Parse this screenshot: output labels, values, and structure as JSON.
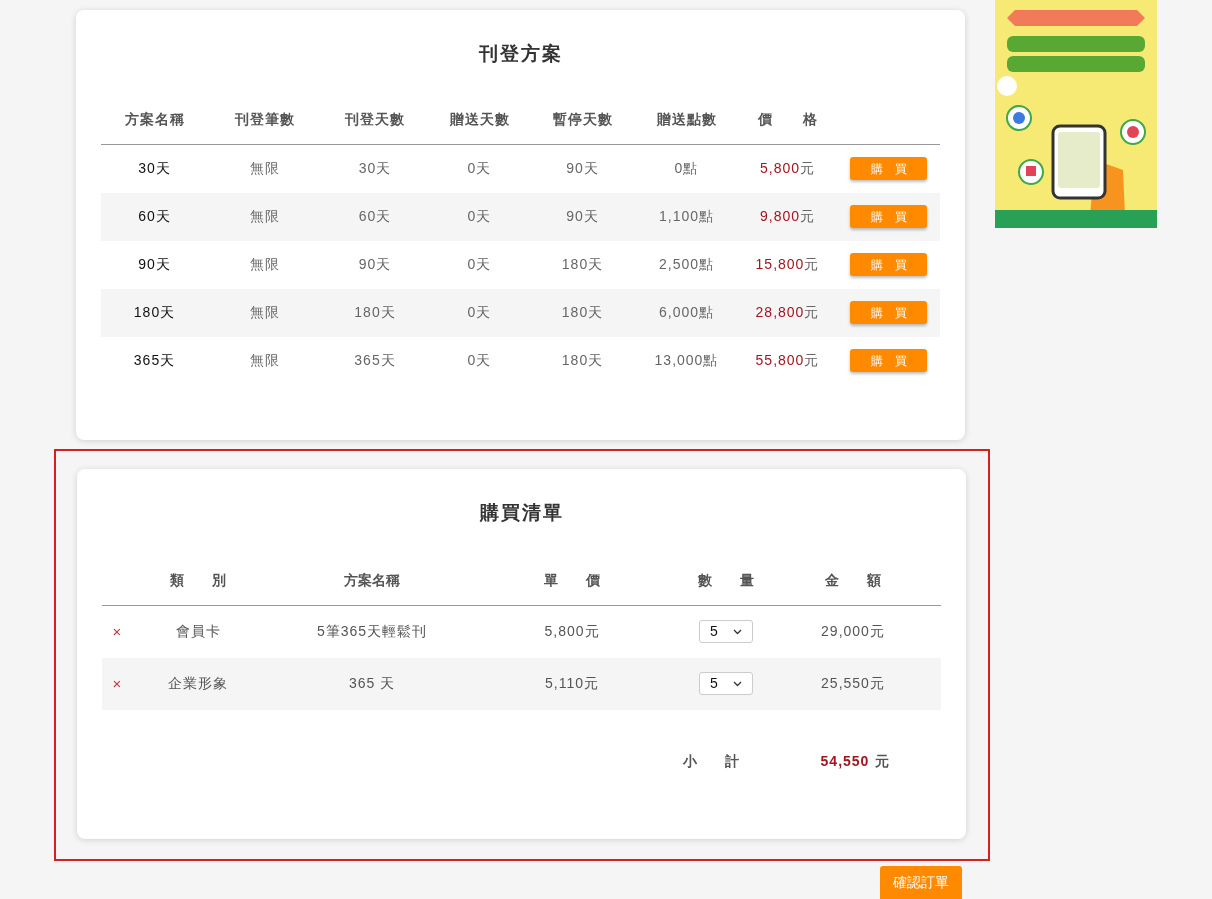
{
  "plans": {
    "title": "刊登方案",
    "columns": [
      "方案名稱",
      "刊登筆數",
      "刊登天數",
      "贈送天數",
      "暫停天數",
      "贈送點數",
      "價　　格"
    ],
    "rows": [
      {
        "name": "30天",
        "listings": "無限",
        "days": "30天",
        "bonus_days": "0天",
        "pause_days": "90天",
        "bonus_points": "0點",
        "price": "5,800元",
        "button": "購　買"
      },
      {
        "name": "60天",
        "listings": "無限",
        "days": "60天",
        "bonus_days": "0天",
        "pause_days": "90天",
        "bonus_points": "1,100點",
        "price": "9,800元",
        "button": "購　買"
      },
      {
        "name": "90天",
        "listings": "無限",
        "days": "90天",
        "bonus_days": "0天",
        "pause_days": "180天",
        "bonus_points": "2,500點",
        "price": "15,800元",
        "button": "購　買"
      },
      {
        "name": "180天",
        "listings": "無限",
        "days": "180天",
        "bonus_days": "0天",
        "pause_days": "180天",
        "bonus_points": "6,000點",
        "price": "28,800元",
        "button": "購　買"
      },
      {
        "name": "365天",
        "listings": "無限",
        "days": "365天",
        "bonus_days": "0天",
        "pause_days": "180天",
        "bonus_points": "13,000點",
        "price": "55,800元",
        "button": "購　買"
      }
    ]
  },
  "cart": {
    "title": "購買清單",
    "highlighted": true,
    "columns": [
      "類　　別",
      "方案名稱",
      "單　　價",
      "數　　量",
      "金　　額"
    ],
    "rows": [
      {
        "remove": "×",
        "category": "會員卡",
        "plan": "5筆365天輕鬆刊",
        "unit_price": "5,800元",
        "quantity": "5",
        "amount": "29,000元"
      },
      {
        "remove": "×",
        "category": "企業形象",
        "plan": "365 天",
        "unit_price": "5,110元",
        "quantity": "5",
        "amount": "25,550元"
      }
    ],
    "subtotal_label": "小　　計",
    "subtotal_value": "54,550",
    "subtotal_unit": "元"
  },
  "confirm_button": "確認訂單"
}
